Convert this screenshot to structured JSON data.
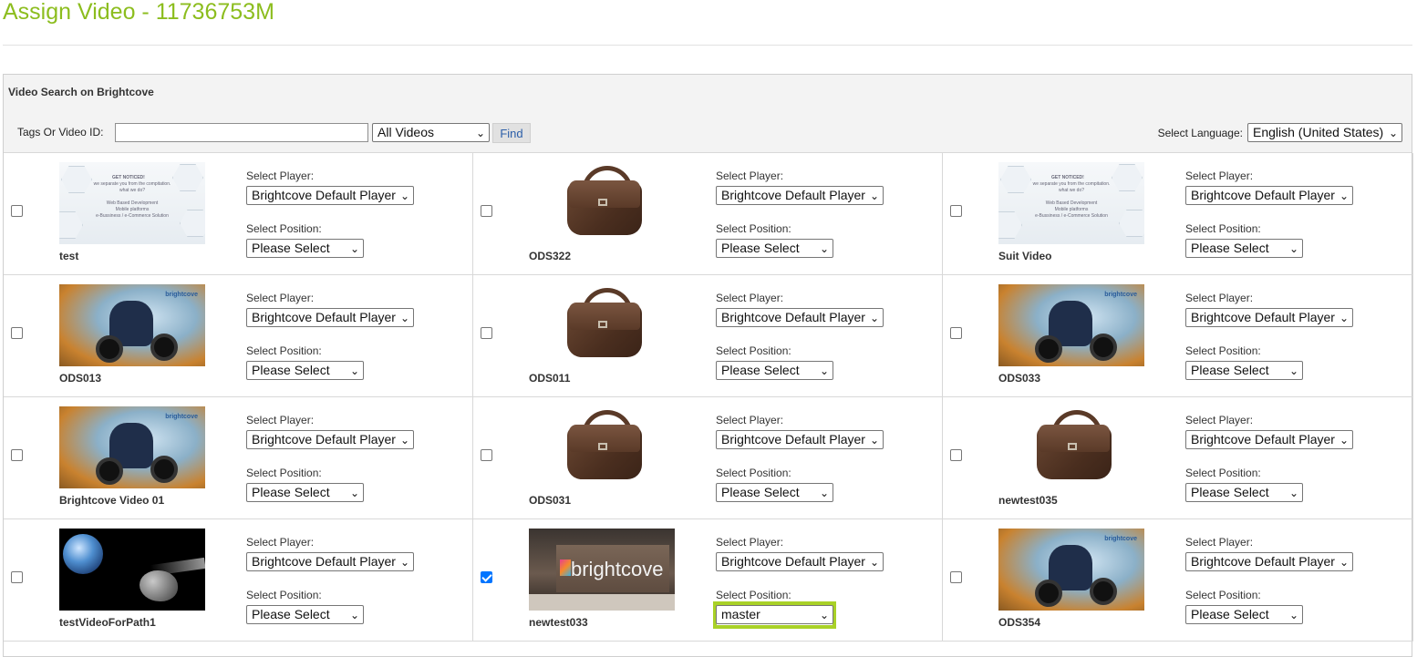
{
  "page": {
    "title": "Assign Video - 11736753M"
  },
  "search": {
    "heading": "Video Search on Brightcove",
    "tags_label": "Tags Or Video ID:",
    "tags_value": "",
    "video_filter": "All Videos",
    "find_label": "Find",
    "language_label": "Select Language:",
    "language_value": "English (United States)"
  },
  "labels": {
    "select_player": "Select Player:",
    "select_position": "Select Position:"
  },
  "videos": [
    {
      "name": "test",
      "thumb": "web-banner",
      "player": "Brightcove Default Player",
      "position": "Please Select",
      "checked": false
    },
    {
      "name": "ODS322",
      "thumb": "leather-bag",
      "player": "Brightcove Default Player",
      "position": "Please Select",
      "checked": false
    },
    {
      "name": "Suit Video",
      "thumb": "web-banner",
      "player": "Brightcove Default Player",
      "position": "Please Select",
      "checked": false
    },
    {
      "name": "ODS013",
      "thumb": "quad-bike",
      "player": "Brightcove Default Player",
      "position": "Please Select",
      "checked": false
    },
    {
      "name": "ODS011",
      "thumb": "leather-bag",
      "player": "Brightcove Default Player",
      "position": "Please Select",
      "checked": false
    },
    {
      "name": "ODS033",
      "thumb": "quad-bike",
      "player": "Brightcove Default Player",
      "position": "Please Select",
      "checked": false
    },
    {
      "name": "Brightcove Video 01",
      "thumb": "quad-bike",
      "player": "Brightcove Default Player",
      "position": "Please Select",
      "checked": false
    },
    {
      "name": "ODS031",
      "thumb": "leather-bag",
      "player": "Brightcove Default Player",
      "position": "Please Select",
      "checked": false
    },
    {
      "name": "newtest035",
      "thumb": "leather-bag",
      "player": "Brightcove Default Player",
      "position": "Please Select",
      "checked": false
    },
    {
      "name": "testVideoForPath1",
      "thumb": "space-earth",
      "player": "Brightcove Default Player",
      "position": "Please Select",
      "checked": false
    },
    {
      "name": "newtest033",
      "thumb": "brightcove-office",
      "player": "Brightcove Default Player",
      "position": "master",
      "checked": true,
      "highlighted": true
    },
    {
      "name": "ODS354",
      "thumb": "quad-bike",
      "player": "Brightcove Default Player",
      "position": "Please Select",
      "checked": false
    }
  ],
  "thumb_text": {
    "web_banner_lines": [
      "GET NOTICED!",
      "we separate you from the compitation.",
      "what we do?",
      "Web Based Development",
      "Mobile platforms",
      "e-Bussiness / e-Commerce Solution"
    ],
    "quad_logo": "brightcove",
    "office_logo": "brightcove"
  },
  "colors": {
    "title": "#8cbd1e",
    "highlight": "#a9d127",
    "checkbox_checked": "#0075ff"
  }
}
